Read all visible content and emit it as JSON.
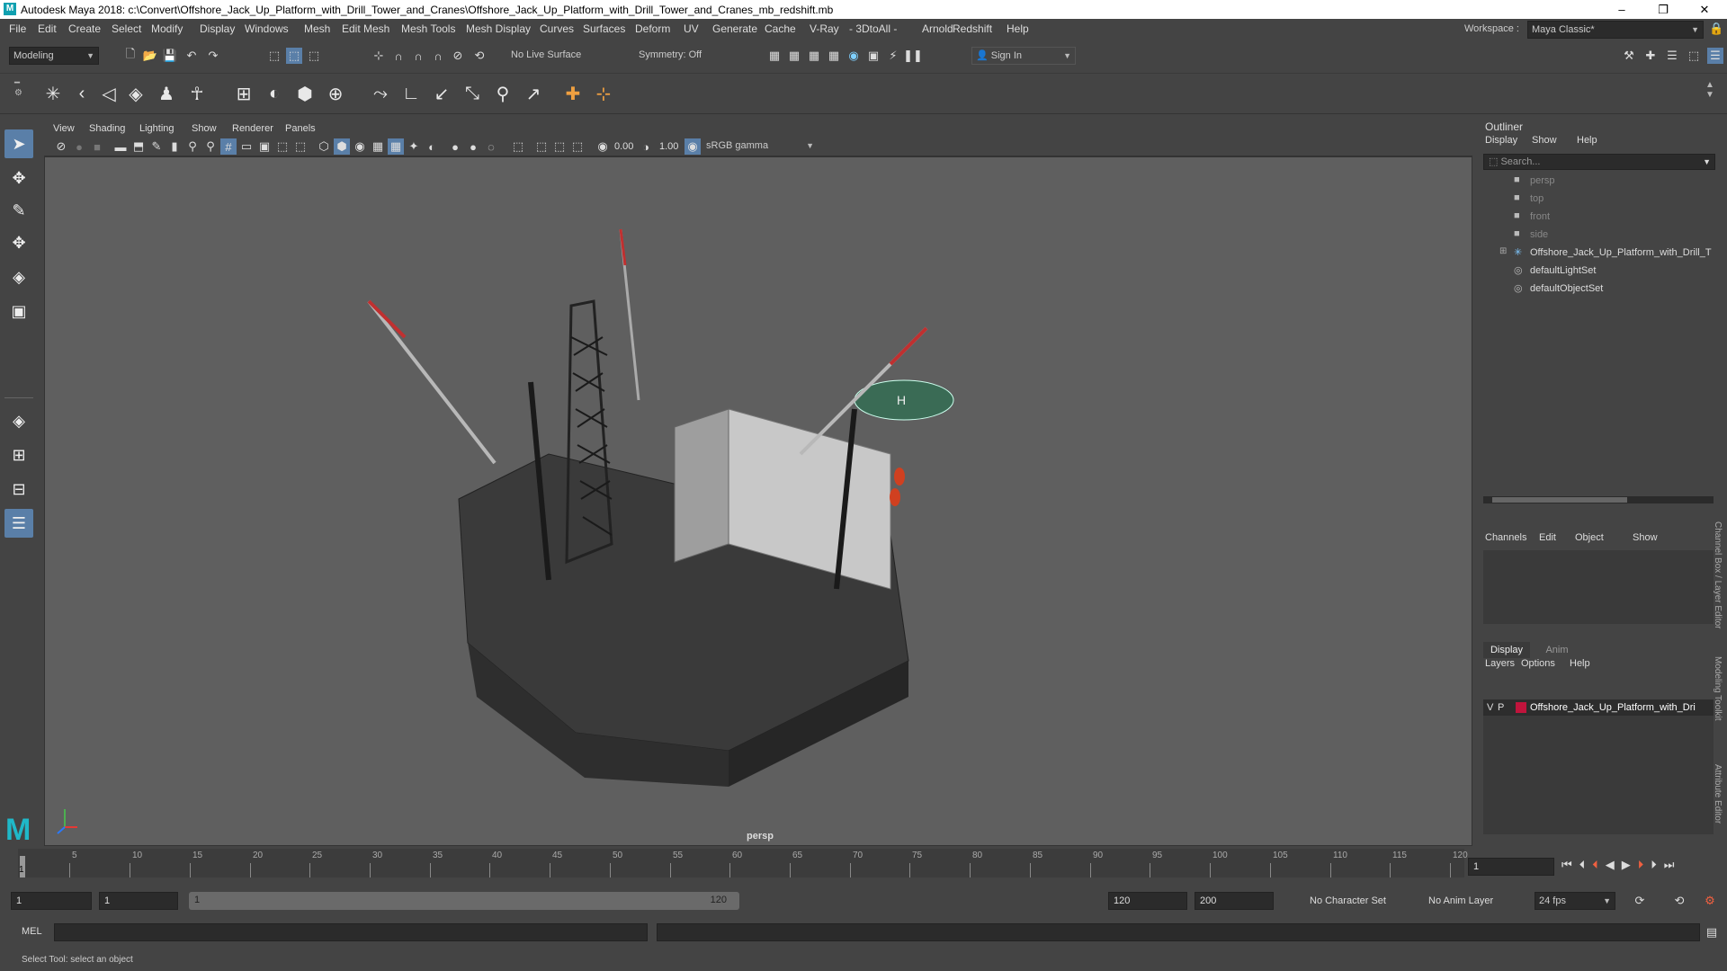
{
  "titlebar": {
    "logo": "M",
    "title": "Autodesk Maya 2018: c:\\Convert\\Offshore_Jack_Up_Platform_with_Drill_Tower_and_Cranes\\Offshore_Jack_Up_Platform_with_Drill_Tower_and_Cranes_mb_redshift.mb",
    "minimize": "–",
    "maximize": "❐",
    "close": "✕"
  },
  "menubar": {
    "items": [
      "File",
      "Edit",
      "Create",
      "Select",
      "Modify",
      "Display",
      "Windows",
      "Mesh",
      "Edit Mesh",
      "Mesh Tools",
      "Mesh Display",
      "Curves",
      "Surfaces",
      "Deform",
      "UV",
      "Generate",
      "Cache",
      "V-Ray",
      "- 3DtoAll -",
      "Arnold",
      "Redshift",
      "Help"
    ],
    "workspace_label": "Workspace :",
    "workspace_value": "Maya Classic*"
  },
  "statusline": {
    "mode": "Modeling",
    "live_surface": "No Live Surface",
    "symmetry": "Symmetry: Off",
    "sign_in": "Sign In"
  },
  "viewport": {
    "menu": [
      "View",
      "Shading",
      "Lighting",
      "Show",
      "Renderer",
      "Panels"
    ],
    "exposure": "0.00",
    "gamma": "1.00",
    "colorspace": "sRGB gamma",
    "camera_label": "persp"
  },
  "outliner": {
    "title": "Outliner",
    "menu": [
      "Display",
      "Show",
      "Help"
    ],
    "search_placeholder": "Search...",
    "items": [
      {
        "label": "persp",
        "type": "camera",
        "dim": true
      },
      {
        "label": "top",
        "type": "camera",
        "dim": true
      },
      {
        "label": "front",
        "type": "camera",
        "dim": true
      },
      {
        "label": "side",
        "type": "camera",
        "dim": true
      },
      {
        "label": "Offshore_Jack_Up_Platform_with_Drill_T",
        "type": "group",
        "dim": false
      },
      {
        "label": "defaultLightSet",
        "type": "set",
        "dim": false
      },
      {
        "label": "defaultObjectSet",
        "type": "set",
        "dim": false
      }
    ]
  },
  "channelbox": {
    "menu": [
      "Channels",
      "Edit",
      "Object",
      "Show"
    ]
  },
  "layereditor": {
    "tabs": [
      "Display",
      "Anim"
    ],
    "menu": [
      "Layers",
      "Options",
      "Help"
    ],
    "layer": {
      "v": "V",
      "p": "P",
      "name": "Offshore_Jack_Up_Platform_with_Dri",
      "color": "#c0143c"
    }
  },
  "sidetabs": [
    "Channel Box / Layer Editor",
    "Modeling Toolkit",
    "Attribute Editor"
  ],
  "timeslider": {
    "ticks": [
      "5",
      "10",
      "15",
      "20",
      "25",
      "30",
      "35",
      "40",
      "45",
      "50",
      "55",
      "60",
      "65",
      "70",
      "75",
      "80",
      "85",
      "90",
      "95",
      "100",
      "105",
      "110",
      "115",
      "120"
    ],
    "current_frame_marker": "1",
    "current_frame": "1"
  },
  "rangeslider": {
    "start": "1",
    "anim_start": "1",
    "range_start": "1",
    "range_end": "120",
    "playback_end": "120",
    "anim_end": "200",
    "character_set": "No Character Set",
    "anim_layer": "No Anim Layer",
    "fps": "24 fps"
  },
  "cmdline": {
    "label": "MEL"
  },
  "helpline": {
    "text": "Select Tool: select an object"
  }
}
